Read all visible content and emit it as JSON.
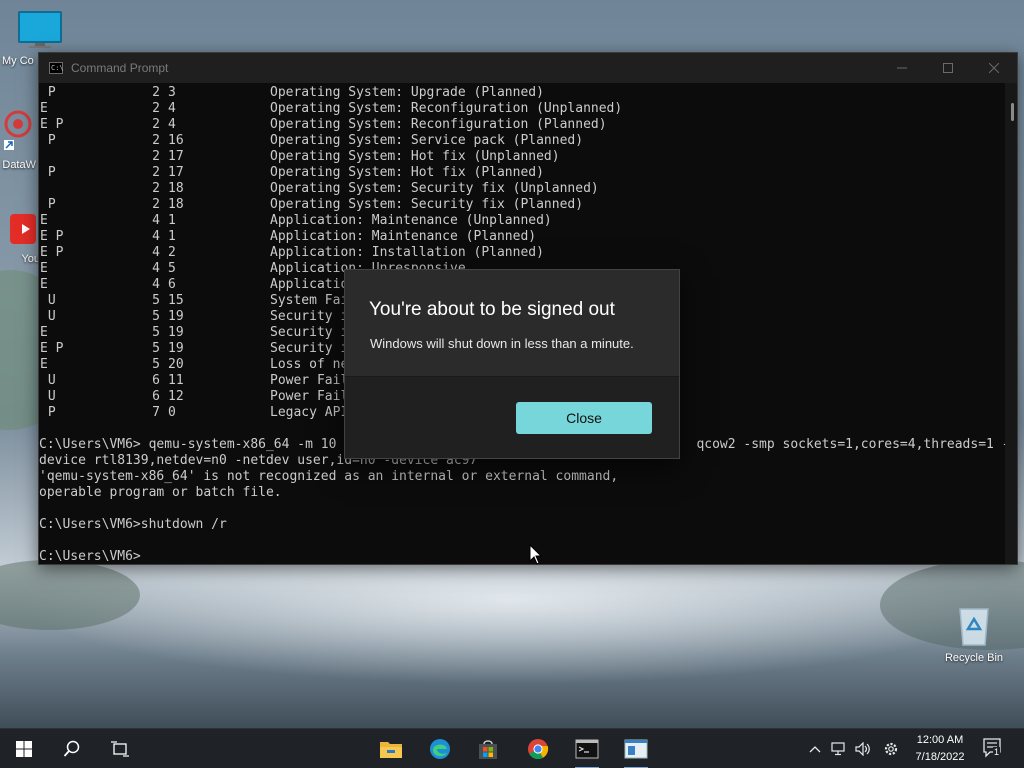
{
  "desktop": {
    "icons": [
      {
        "label": "My Co"
      },
      {
        "label": "DataW"
      },
      {
        "label": "You"
      },
      {
        "label": "Recycle Bin"
      }
    ]
  },
  "cmd": {
    "title": "Command Prompt",
    "rows": [
      {
        "flag": " P",
        "major": "2",
        "minor": "3",
        "desc": "Operating System: Upgrade (Planned)"
      },
      {
        "flag": "E",
        "major": "2",
        "minor": "4",
        "desc": "Operating System: Reconfiguration (Unplanned)"
      },
      {
        "flag": "E P",
        "major": "2",
        "minor": "4",
        "desc": "Operating System: Reconfiguration (Planned)"
      },
      {
        "flag": " P",
        "major": "2",
        "minor": "16",
        "desc": "Operating System: Service pack (Planned)"
      },
      {
        "flag": "",
        "major": "2",
        "minor": "17",
        "desc": "Operating System: Hot fix (Unplanned)"
      },
      {
        "flag": " P",
        "major": "2",
        "minor": "17",
        "desc": "Operating System: Hot fix (Planned)"
      },
      {
        "flag": "",
        "major": "2",
        "minor": "18",
        "desc": "Operating System: Security fix (Unplanned)"
      },
      {
        "flag": " P",
        "major": "2",
        "minor": "18",
        "desc": "Operating System: Security fix (Planned)"
      },
      {
        "flag": "E",
        "major": "4",
        "minor": "1",
        "desc": "Application: Maintenance (Unplanned)"
      },
      {
        "flag": "E P",
        "major": "4",
        "minor": "1",
        "desc": "Application: Maintenance (Planned)"
      },
      {
        "flag": "E P",
        "major": "4",
        "minor": "2",
        "desc": "Application: Installation (Planned)"
      },
      {
        "flag": "E",
        "major": "4",
        "minor": "5",
        "desc": "Application: Unresponsive"
      },
      {
        "flag": "E",
        "major": "4",
        "minor": "6",
        "desc": "Application: U"
      },
      {
        "flag": " U",
        "major": "5",
        "minor": "15",
        "desc": "System Failure"
      },
      {
        "flag": " U",
        "major": "5",
        "minor": "19",
        "desc": "Security issue"
      },
      {
        "flag": "E",
        "major": "5",
        "minor": "19",
        "desc": "Security issue"
      },
      {
        "flag": "E P",
        "major": "5",
        "minor": "19",
        "desc": "Security issue"
      },
      {
        "flag": "E",
        "major": "5",
        "minor": "20",
        "desc": "Loss of networ"
      },
      {
        "flag": " U",
        "major": "6",
        "minor": "11",
        "desc": "Power Failure:"
      },
      {
        "flag": " U",
        "major": "6",
        "minor": "12",
        "desc": "Power Failure:"
      },
      {
        "flag": " P",
        "major": "7",
        "minor": "0",
        "desc": "Legacy API shu"
      }
    ],
    "lines": [
      "",
      "C:\\Users\\VM6> qemu-system-x86_64 -m 10                                              qcow2 -smp sockets=1,cores=4,threads=1 -",
      "device rtl8139,netdev=n0 -netdev user,id=n0 -device ac97",
      "'qemu-system-x86_64' is not recognized as an internal or external command,",
      "operable program or batch file.",
      "",
      "C:\\Users\\VM6>shutdown /r",
      "",
      "C:\\Users\\VM6>"
    ]
  },
  "dialog": {
    "title": "You're about to be signed out",
    "message": "Windows will shut down in less than a minute.",
    "close_label": "Close",
    "button_color": "#76d6da"
  },
  "taskbar": {
    "items": [
      "start-icon",
      "search-icon",
      "task-view-icon",
      "file-explorer-icon",
      "edge-icon",
      "store-icon",
      "chrome-icon",
      "command-prompt-icon",
      "app-icon"
    ],
    "time": "12:00 AM",
    "date": "7/18/2022",
    "notification_count": "1"
  }
}
